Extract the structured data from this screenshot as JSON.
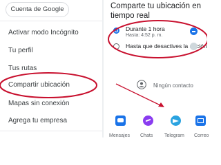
{
  "menu": {
    "account_button": "Cuenta de Google",
    "items": [
      {
        "label": "Activar modo Incógnito"
      },
      {
        "label": "Tu perfil"
      },
      {
        "label": "Tus rutas"
      },
      {
        "label": "Compartir ubicación"
      },
      {
        "label": "Mapas sin conexión"
      },
      {
        "label": "Agrega tu empresa"
      }
    ],
    "highlight_color": "#c8102e"
  },
  "share": {
    "title_line1": "Comparte tu ubicación en",
    "title_line2": "tiempo real",
    "options": [
      {
        "label": "Durante 1 hora",
        "sublabel": "Hasta: 4:52 p. m.",
        "selected": true
      },
      {
        "label": "Hasta que desactives la opción",
        "selected": false
      }
    ],
    "contact_label": "Ningún contacto",
    "accent_color": "#1a73e8",
    "apps": [
      {
        "label": "Mensajes",
        "icon": "messages-icon",
        "color": "#1a73e8"
      },
      {
        "label": "Chats",
        "icon": "messenger-icon",
        "color": "#8a3cf0"
      },
      {
        "label": "Telegram",
        "icon": "telegram-icon",
        "color": "#2aa3e0"
      },
      {
        "label": "Correo",
        "icon": "mail-icon",
        "color": "#1a73e8"
      }
    ]
  }
}
